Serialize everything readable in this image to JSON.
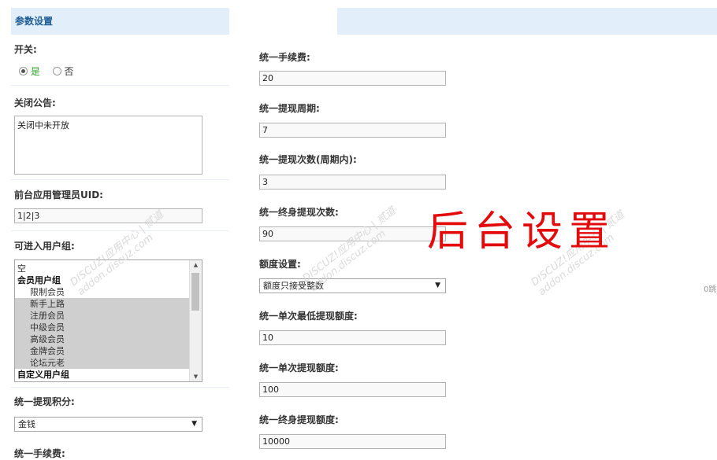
{
  "header": {
    "title": "参数设置"
  },
  "left": {
    "switch": {
      "label": "开关:",
      "options": [
        {
          "label": "是",
          "checked": true,
          "color": "#2aa52a"
        },
        {
          "label": "否",
          "checked": false,
          "color": "#333333"
        }
      ]
    },
    "notice": {
      "label": "关闭公告:",
      "value": "关闭中未开放"
    },
    "admin_uid": {
      "label": "前台应用管理员UID:",
      "value": "1|2|3"
    },
    "groups": {
      "label": "可进入用户组:",
      "items": [
        {
          "text": "空",
          "kind": "plain",
          "selected": false
        },
        {
          "text": "会员用户组",
          "kind": "group",
          "selected": false
        },
        {
          "text": "限制会员",
          "kind": "child",
          "selected": false
        },
        {
          "text": "新手上路",
          "kind": "child",
          "selected": true
        },
        {
          "text": "注册会员",
          "kind": "child",
          "selected": true
        },
        {
          "text": "中级会员",
          "kind": "child",
          "selected": true
        },
        {
          "text": "高级会员",
          "kind": "child",
          "selected": true
        },
        {
          "text": "金牌会员",
          "kind": "child",
          "selected": true
        },
        {
          "text": "论坛元老",
          "kind": "child",
          "selected": true
        },
        {
          "text": "自定义用户组",
          "kind": "group",
          "selected": false
        }
      ]
    },
    "points": {
      "label": "统一提现积分:",
      "value": "金钱"
    },
    "fee_cut": {
      "label": "统一手续费:"
    }
  },
  "right": {
    "fee": {
      "label": "统一手续费:",
      "value": "20"
    },
    "period": {
      "label": "统一提现周期:",
      "value": "7"
    },
    "count_period": {
      "label": "统一提现次数(周期内):",
      "value": "3"
    },
    "count_life": {
      "label": "统一终身提现次数:",
      "value": "90"
    },
    "quota_setting": {
      "label": "额度设置:",
      "value": "额度只接受整数"
    },
    "min_single": {
      "label": "统一单次最低提现额度:",
      "value": "10"
    },
    "single": {
      "label": "统一单次提现额度:",
      "value": "100"
    },
    "life_quota": {
      "label": "统一终身提现额度:",
      "value": "10000"
    }
  },
  "overlay": {
    "text": "后台设置"
  },
  "watermark": {
    "line1": "DISCUZ!应用中心 | 贰道",
    "line2": "addon.discuz.com"
  },
  "edge_text": "0跳"
}
